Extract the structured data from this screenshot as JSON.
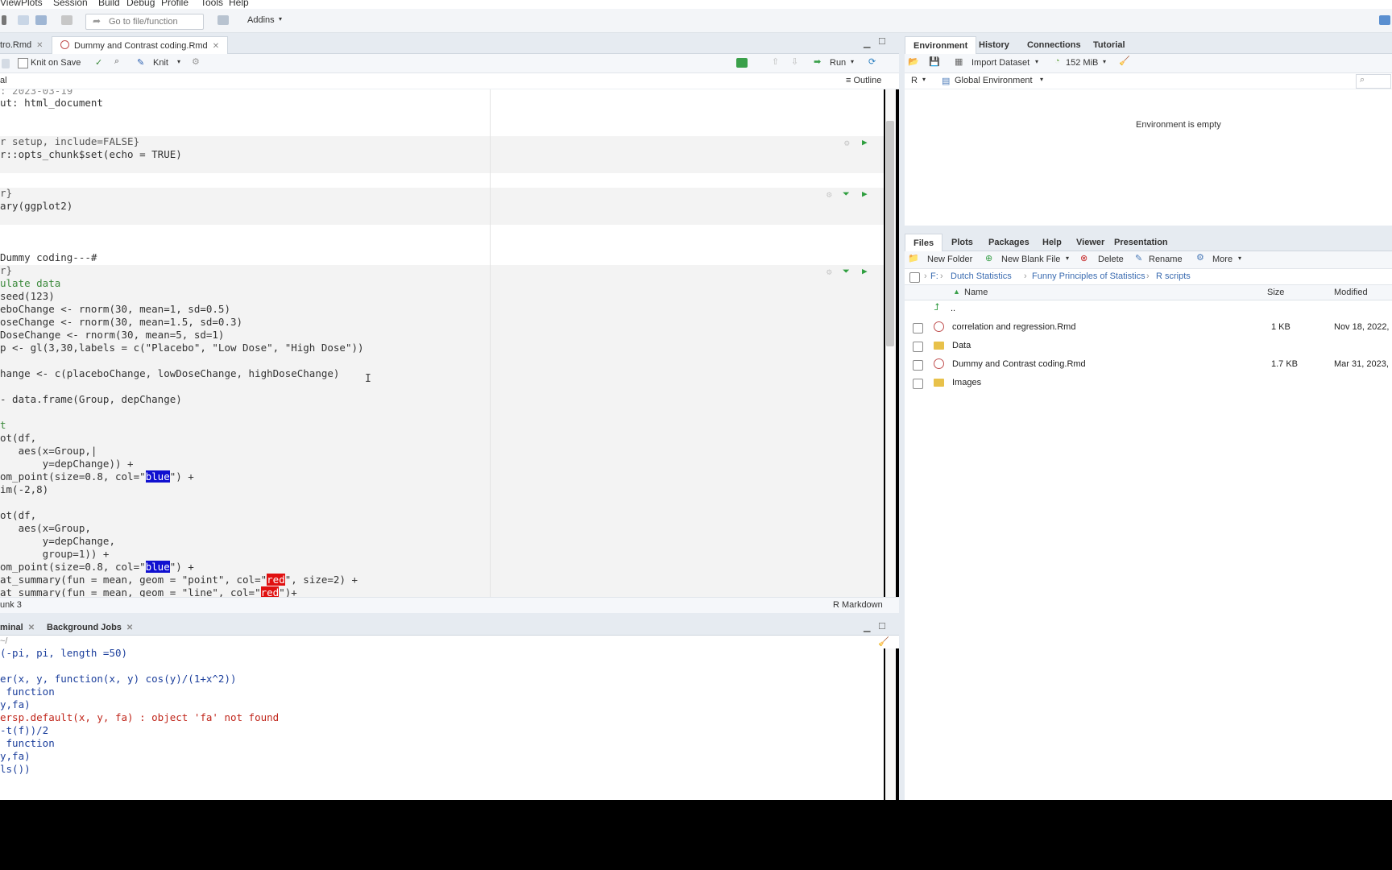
{
  "menu": [
    "View",
    "Plots",
    "Session",
    "Build",
    "Debug",
    "Profile",
    "Tools",
    "Help"
  ],
  "toolbar": {
    "goto_placeholder": "Go to file/function",
    "addins": "Addins"
  },
  "source": {
    "tabs": [
      {
        "label": "tro.Rmd"
      },
      {
        "label": "Dummy and Contrast coding.Rmd"
      }
    ],
    "knit_on_save": "Knit on Save",
    "knit": "Knit",
    "run": "Run",
    "outline": "Outline",
    "mode_label": "al",
    "status_left": "unk 3",
    "status_right": "R Markdown",
    "lines": [
      {
        "t": ": 2023-03-19"
      },
      {
        "t": "ut: html_document"
      },
      {
        "t": "r setup, include=FALSE}"
      },
      {
        "t": "r::opts_chunk$set(echo = TRUE)"
      },
      {
        "t": "r}"
      },
      {
        "t": "ary(ggplot2)"
      },
      {
        "t": "Dummy coding---#"
      },
      {
        "t": "r}"
      },
      {
        "t": "ulate data"
      },
      {
        "t": "seed(123)"
      },
      {
        "t": "eboChange <- rnorm(30, mean=1, sd=0.5)"
      },
      {
        "t": "oseChange <- rnorm(30, mean=1.5, sd=0.3)"
      },
      {
        "t": "DoseChange <- rnorm(30, mean=5, sd=1)"
      },
      {
        "t": "p <- gl(3,30,labels = c(\"Placebo\", \"Low Dose\", \"High Dose\"))"
      },
      {
        "t": "hange <- c(placeboChange, lowDoseChange, highDoseChange)"
      },
      {
        "t": "- data.frame(Group, depChange)"
      },
      {
        "t": "t"
      },
      {
        "t": "ot(df,"
      },
      {
        "t": "   aes(x=Group,|"
      },
      {
        "t": "       y=depChange)) +"
      },
      {
        "t": "om_point(size=0.8, col=\"",
        "hl": "blue",
        "t2": "\") +"
      },
      {
        "t": "im(-2,8)"
      },
      {
        "t": "ot(df,"
      },
      {
        "t": "   aes(x=Group,"
      },
      {
        "t": "       y=depChange,"
      },
      {
        "t": "       group=1)) +"
      },
      {
        "t": "om_point(size=0.8, col=\"",
        "hl": "blue",
        "t2": "\") +"
      },
      {
        "t": "at_summary(fun = mean, geom = \"point\", col=\"",
        "hlr": "red",
        "t2": "\", size=2) +"
      },
      {
        "t": "at_summary(fun = mean, geom = \"line\", col=\"",
        "hlr": "red",
        "t2": "\")+"
      }
    ]
  },
  "console": {
    "tabs": [
      {
        "label": "minal"
      },
      {
        "label": "Background Jobs"
      }
    ],
    "path": "~/",
    "lines": [
      {
        "t": "(-pi, pi, length =50)"
      },
      {
        "t": "er(x, y, function(x, y) cos(y)/(1+x^2))"
      },
      {
        "t": " function"
      },
      {
        "t": "y,fa)"
      },
      {
        "t": "ersp.default(x, y, fa) : object 'fa' not found",
        "err": true
      },
      {
        "t": "-t(f))/2"
      },
      {
        "t": " function"
      },
      {
        "t": "y,fa)"
      },
      {
        "t": "ls())"
      }
    ]
  },
  "environment": {
    "tabs": [
      "Environment",
      "History",
      "Connections",
      "Tutorial"
    ],
    "import_dataset": "Import Dataset",
    "memory": "152 MiB",
    "lang": "R",
    "scope": "Global Environment",
    "empty_msg": "Environment is empty"
  },
  "files": {
    "tabs": [
      "Files",
      "Plots",
      "Packages",
      "Help",
      "Viewer",
      "Presentation"
    ],
    "toolbar": {
      "new_folder": "New Folder",
      "new_blank": "New Blank File",
      "delete": "Delete",
      "rename": "Rename",
      "more": "More"
    },
    "path": [
      "F:",
      "Dutch Statistics",
      "Funny Principles of Statistics",
      "R scripts"
    ],
    "headers": {
      "name": "Name",
      "size": "Size",
      "modified": "Modified"
    },
    "parent": "..",
    "items": [
      {
        "name": "correlation and regression.Rmd",
        "size": "1 KB",
        "modified": "Nov 18, 2022,",
        "type": "rmd"
      },
      {
        "name": "Data",
        "size": "",
        "modified": "",
        "type": "folder"
      },
      {
        "name": "Dummy and Contrast coding.Rmd",
        "size": "1.7 KB",
        "modified": "Mar 31, 2023,",
        "type": "rmd"
      },
      {
        "name": "Images",
        "size": "",
        "modified": "",
        "type": "folder"
      }
    ]
  }
}
